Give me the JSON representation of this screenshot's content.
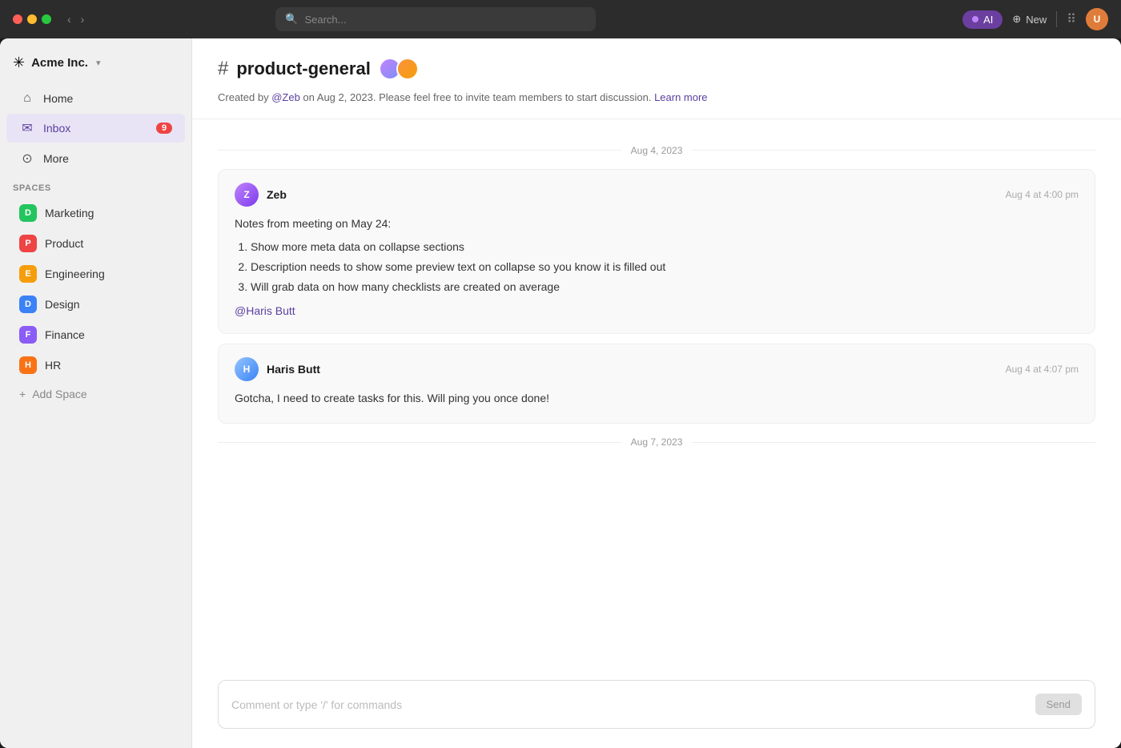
{
  "titlebar": {
    "search_placeholder": "Search...",
    "ai_label": "AI",
    "new_label": "New",
    "user_initials": "U"
  },
  "sidebar": {
    "logo": {
      "text": "Acme Inc.",
      "chevron": "▾"
    },
    "nav_items": [
      {
        "id": "home",
        "icon": "⌂",
        "label": "Home"
      },
      {
        "id": "inbox",
        "icon": "✉",
        "label": "Inbox",
        "badge": "9"
      },
      {
        "id": "more",
        "icon": "⊙",
        "label": "More"
      }
    ],
    "spaces_title": "Spaces",
    "spaces": [
      {
        "id": "marketing",
        "letter": "D",
        "label": "Marketing",
        "color": "#22c55e"
      },
      {
        "id": "product",
        "letter": "P",
        "label": "Product",
        "color": "#ef4444"
      },
      {
        "id": "engineering",
        "letter": "E",
        "label": "Engineering",
        "color": "#f59e0b"
      },
      {
        "id": "design",
        "letter": "D",
        "label": "Design",
        "color": "#3b82f6"
      },
      {
        "id": "finance",
        "letter": "F",
        "label": "Finance",
        "color": "#8b5cf6"
      },
      {
        "id": "hr",
        "letter": "H",
        "label": "HR",
        "color": "#f97316"
      }
    ],
    "add_space_label": "Add Space"
  },
  "channel": {
    "hash": "#",
    "title": "product-general",
    "description_prefix": "Created by ",
    "description_author": "@Zeb",
    "description_middle": " on Aug 2, 2023. Please feel free to invite team members to start discussion. ",
    "description_learn_more": "Learn more"
  },
  "messages": {
    "date_1": "Aug 4, 2023",
    "msg1": {
      "author": "Zeb",
      "time": "Aug 4 at 4:00 pm",
      "intro": "Notes from meeting on May 24:",
      "items": [
        "Show more meta data on collapse sections",
        "Description needs to show some preview text on collapse so you know it is filled out",
        "Will grab data on how many checklists are created on average"
      ],
      "mention": "@Haris Butt"
    },
    "msg2": {
      "author": "Haris Butt",
      "time": "Aug 4 at 4:07 pm",
      "text": "Gotcha, I need to create tasks for this. Will ping you once done!"
    },
    "date_2": "Aug 7, 2023"
  },
  "comment_box": {
    "placeholder": "Comment or type '/' for commands",
    "send_label": "Send"
  }
}
